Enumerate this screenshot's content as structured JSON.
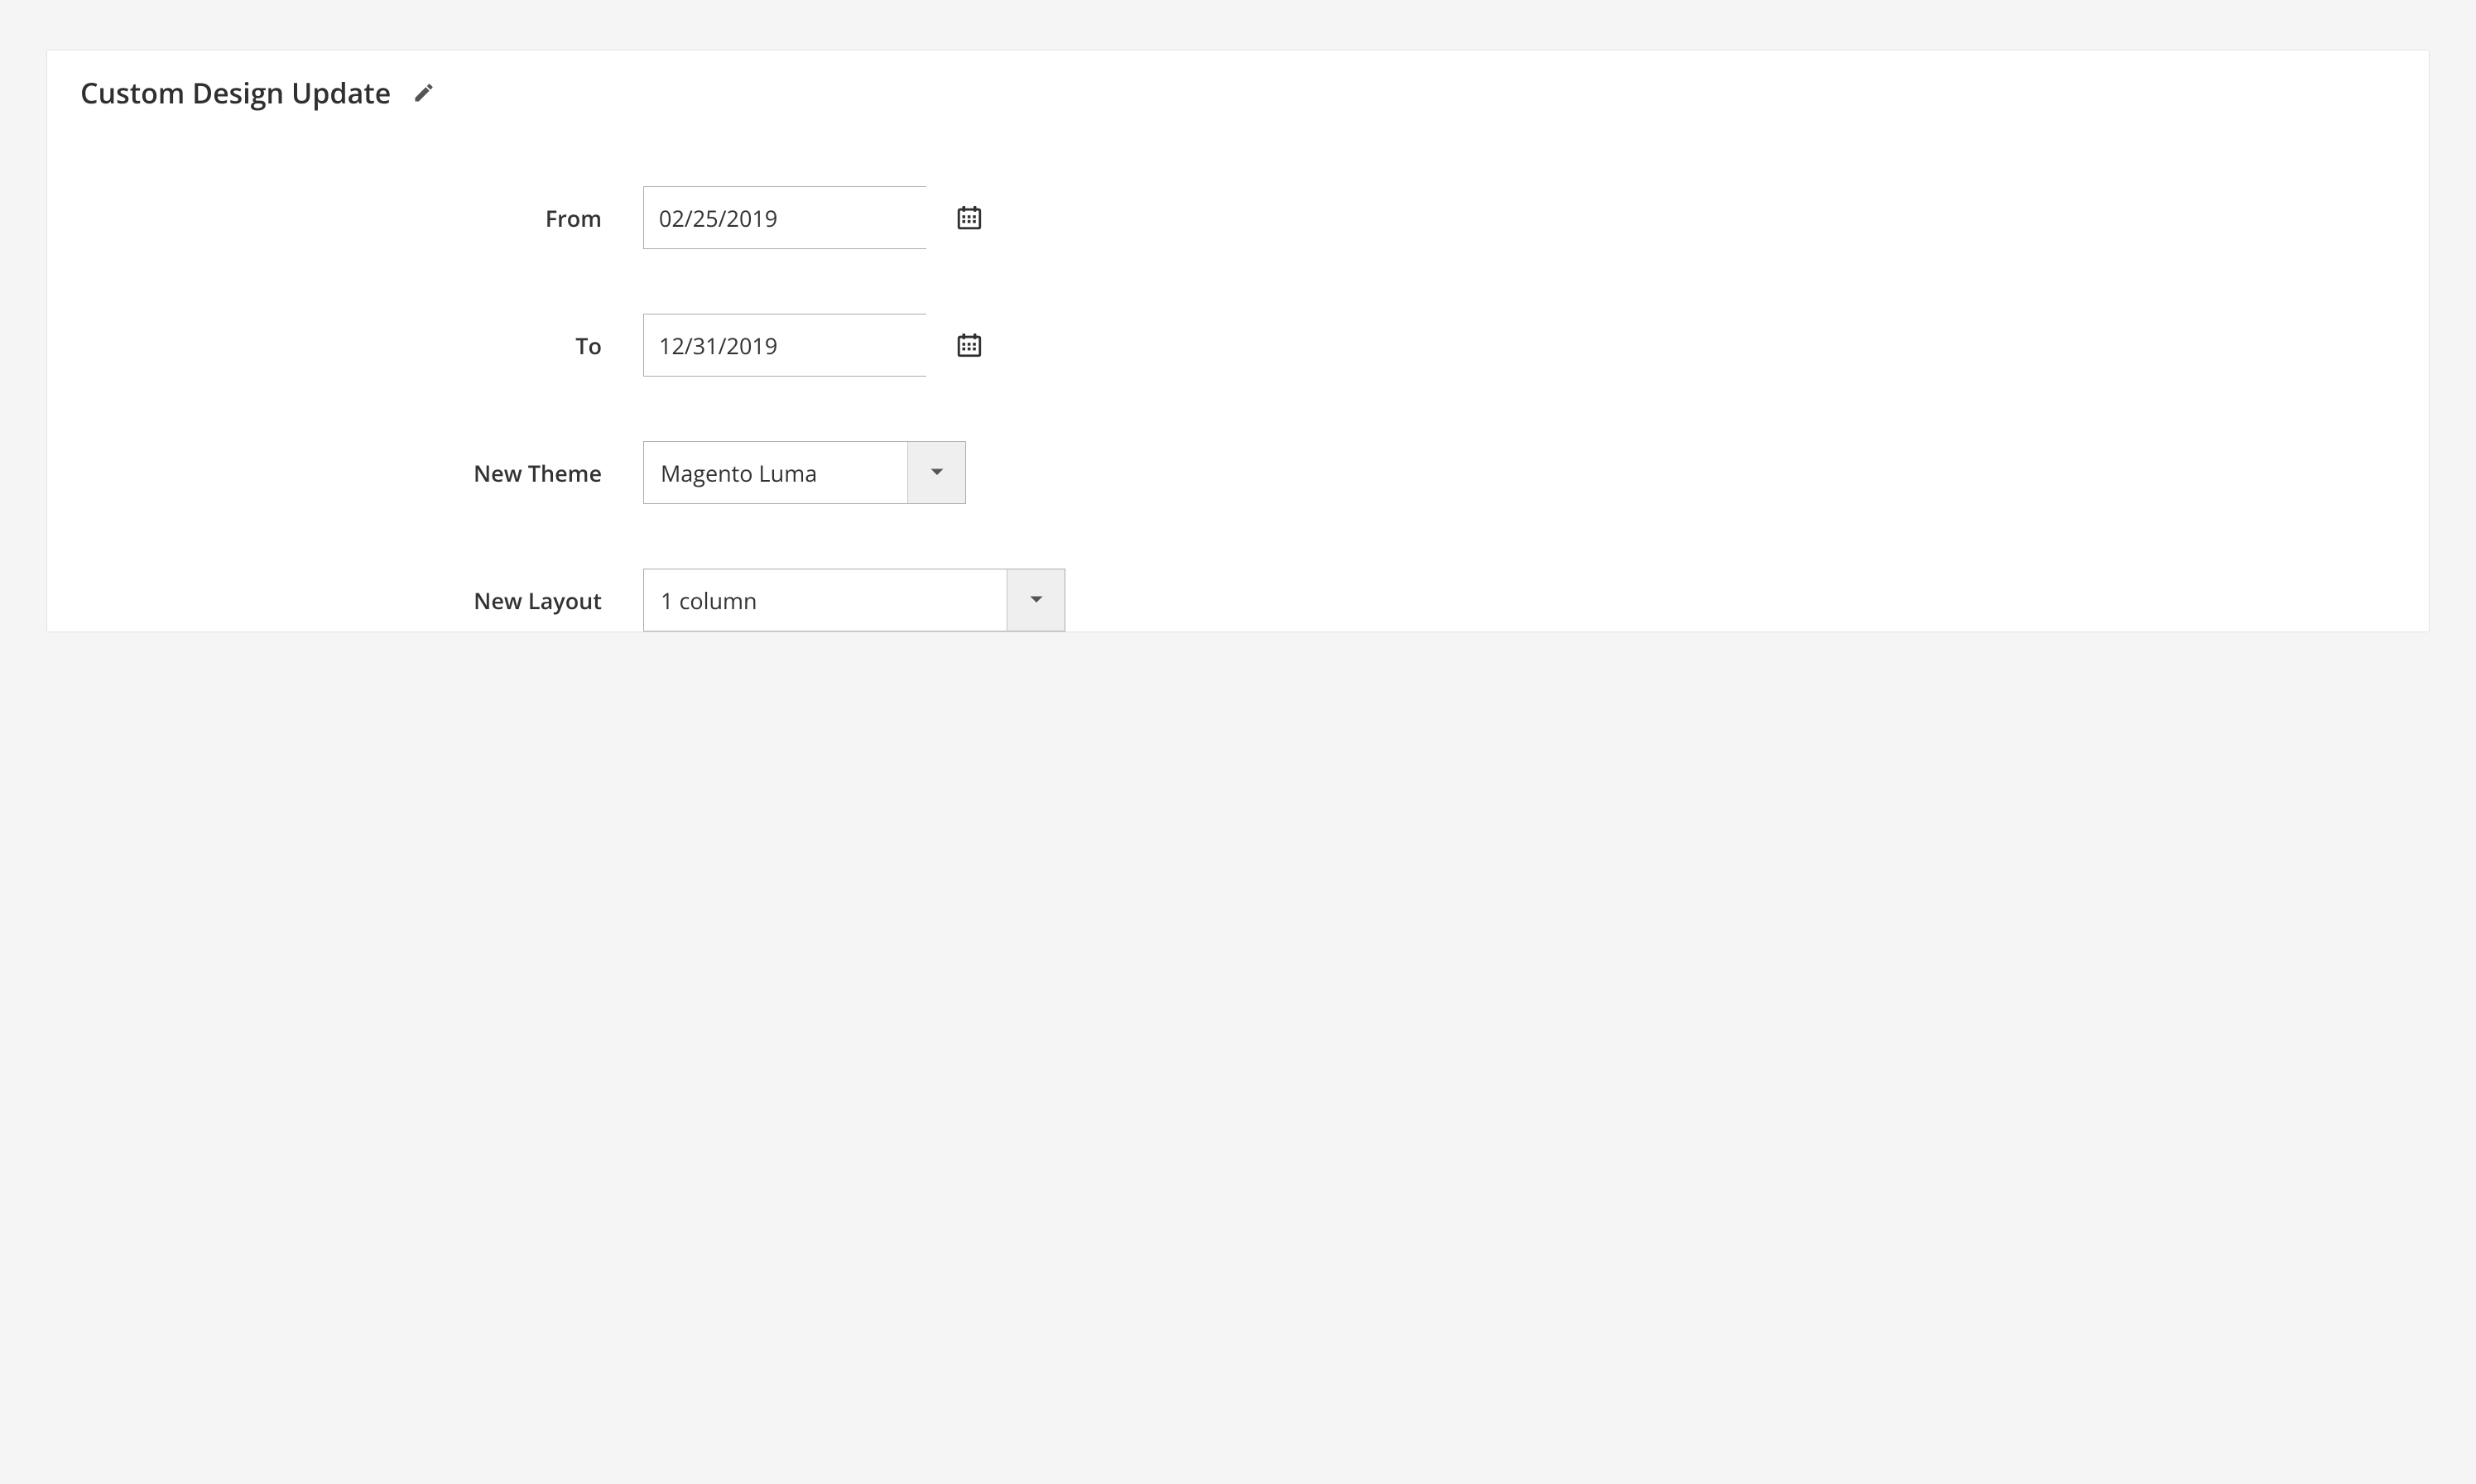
{
  "panel": {
    "title": "Custom Design Update"
  },
  "fields": {
    "from": {
      "label": "From",
      "value": "02/25/2019"
    },
    "to": {
      "label": "To",
      "value": "12/31/2019"
    },
    "theme": {
      "label": "New Theme",
      "value": "Magento Luma"
    },
    "layout": {
      "label": "New Layout",
      "value": "1 column"
    }
  }
}
